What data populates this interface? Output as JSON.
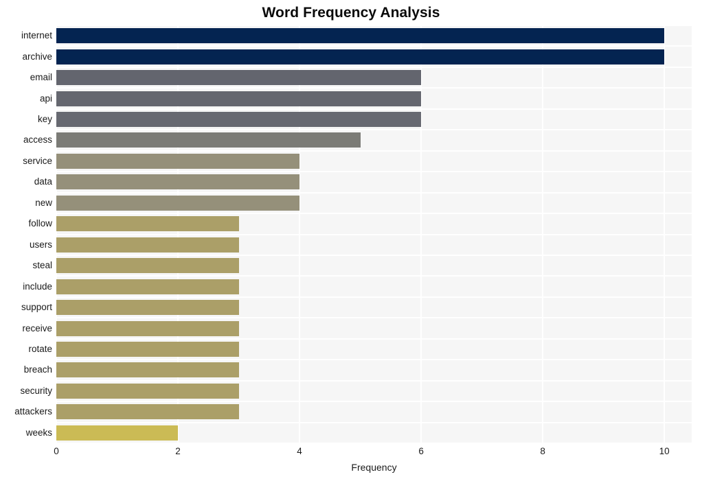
{
  "chart_data": {
    "type": "bar",
    "orientation": "horizontal",
    "title": "Word Frequency Analysis",
    "xlabel": "Frequency",
    "ylabel": "",
    "xlim": [
      0,
      10.45
    ],
    "xticks": [
      0,
      2,
      4,
      6,
      8,
      10
    ],
    "xtick_labels": [
      "0",
      "2",
      "4",
      "6",
      "8",
      "10"
    ],
    "grid": true,
    "grid_color": "#ffffff",
    "plot_background": "#f6f6f6",
    "figure_background": "#ffffff",
    "legend": null,
    "categories": [
      "internet",
      "archive",
      "email",
      "api",
      "key",
      "access",
      "service",
      "data",
      "new",
      "follow",
      "users",
      "steal",
      "include",
      "support",
      "receive",
      "rotate",
      "breach",
      "security",
      "attackers",
      "weeks"
    ],
    "values": [
      10,
      10,
      6,
      6,
      6,
      5,
      4,
      4,
      4,
      3,
      3,
      3,
      3,
      3,
      3,
      3,
      3,
      3,
      3,
      2
    ],
    "bar_colors": [
      "#042451",
      "#042451",
      "#63656e",
      "#65676f",
      "#676971",
      "#7b7b76",
      "#95907a",
      "#95907a",
      "#95907a",
      "#ab9f68",
      "#ab9f68",
      "#ab9f68",
      "#ab9f68",
      "#ab9f68",
      "#ab9f68",
      "#ab9f68",
      "#ab9f68",
      "#ab9f68",
      "#ab9f68",
      "#cbbb55"
    ]
  }
}
